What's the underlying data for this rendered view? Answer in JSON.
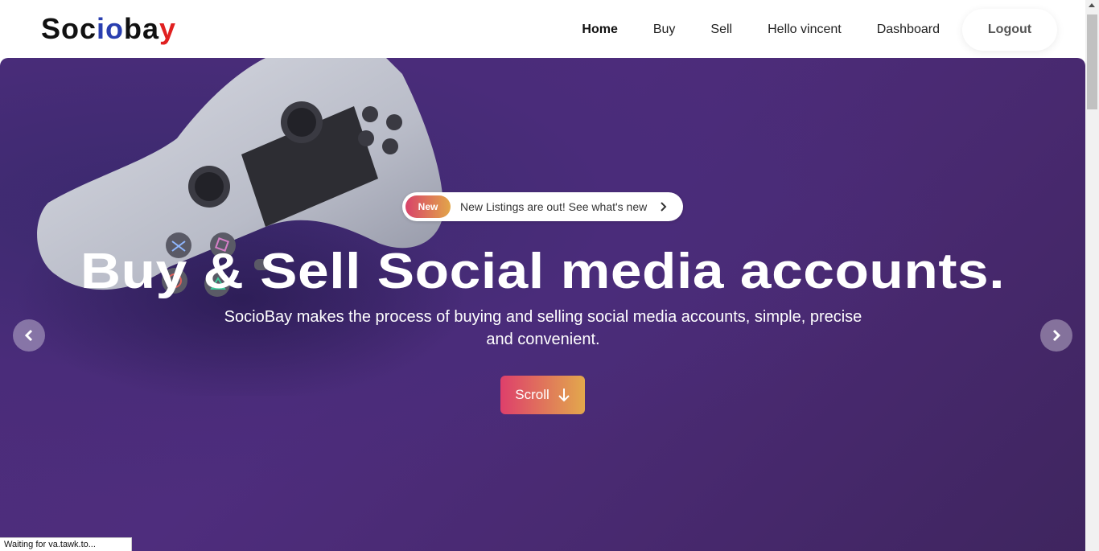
{
  "brand": {
    "part1": "Soc",
    "part2": "io",
    "part3": "ba",
    "part4": "y"
  },
  "nav": {
    "home": "Home",
    "buy": "Buy",
    "sell": "Sell",
    "greeting": "Hello vincent",
    "dashboard": "Dashboard",
    "logout": "Logout"
  },
  "hero": {
    "badge": "New",
    "announcement": "New Listings are out! See what's new",
    "headline": "Buy & Sell Social media accounts.",
    "subtitle": "SocioBay makes the process of buying and selling social media accounts, simple, precise and convenient.",
    "scroll_label": "Scroll"
  },
  "icons": {
    "prev": "chevron-left-icon",
    "next": "chevron-right-icon",
    "scroll": "arrow-down-icon"
  },
  "colors": {
    "hero_purple": "#4b2c78",
    "accent_pink": "#de3f6b",
    "accent_gold": "#e2a84c",
    "logo_blue": "#2a3fb0",
    "logo_red": "#e02020"
  },
  "status_bar": "Waiting for va.tawk.to..."
}
